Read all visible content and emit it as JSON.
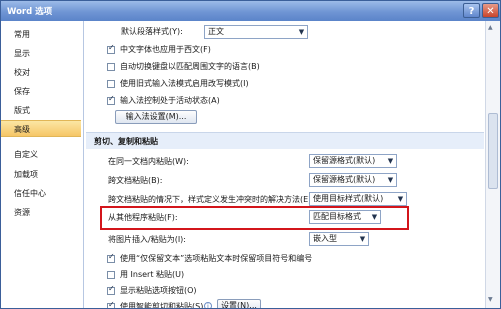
{
  "window": {
    "title": "Word 选项",
    "help_icon": "?",
    "close_icon": "✕"
  },
  "sidebar": {
    "items": [
      {
        "label": "常用"
      },
      {
        "label": "显示"
      },
      {
        "label": "校对"
      },
      {
        "label": "保存"
      },
      {
        "label": "版式"
      },
      {
        "label": "高级",
        "selected": true
      },
      {
        "label": "自定义"
      },
      {
        "label": "加载项"
      },
      {
        "label": "信任中心"
      },
      {
        "label": "资源"
      }
    ]
  },
  "top": {
    "default_para_label": "默认段落样式(Y):",
    "default_para_value": "正文",
    "checkboxes": [
      {
        "label": "中文字体也应用于西文(F)",
        "checked": true
      },
      {
        "label": "自动切换键盘以匹配周围文字的语言(B)",
        "checked": false
      },
      {
        "label": "使用旧式输入法模式启用改写模式(I)",
        "checked": false
      },
      {
        "label": "输入法控制处于活动状态(A)",
        "checked": true
      }
    ],
    "ime_button": "输入法设置(M)..."
  },
  "paste_section": {
    "title": "剪切、复制和粘贴",
    "options": [
      {
        "label": "在同一文档内粘贴(W):",
        "value": "保留源格式(默认)"
      },
      {
        "label": "跨文档粘贴(B):",
        "value": "保留源格式(默认)"
      },
      {
        "label": "跨文档粘贴的情况下，样式定义发生冲突时的解决方法(E):",
        "value": "使用目标样式(默认)"
      },
      {
        "label": "从其他程序粘贴(F):",
        "value": "匹配目标格式"
      },
      {
        "label": "将图片插入/粘贴为(I):",
        "value": "嵌入型"
      }
    ],
    "checkboxes": [
      {
        "label": "使用“仅保留文本”选项粘贴文本时保留项目符号和编号",
        "checked": true
      },
      {
        "label": "用 Insert 粘贴(U)",
        "checked": false
      },
      {
        "label": "显示粘贴选项按钮(O)",
        "checked": true
      },
      {
        "label": "使用智能剪切和粘贴(S)",
        "checked": true
      }
    ],
    "settings_button": "设置(N)..."
  }
}
